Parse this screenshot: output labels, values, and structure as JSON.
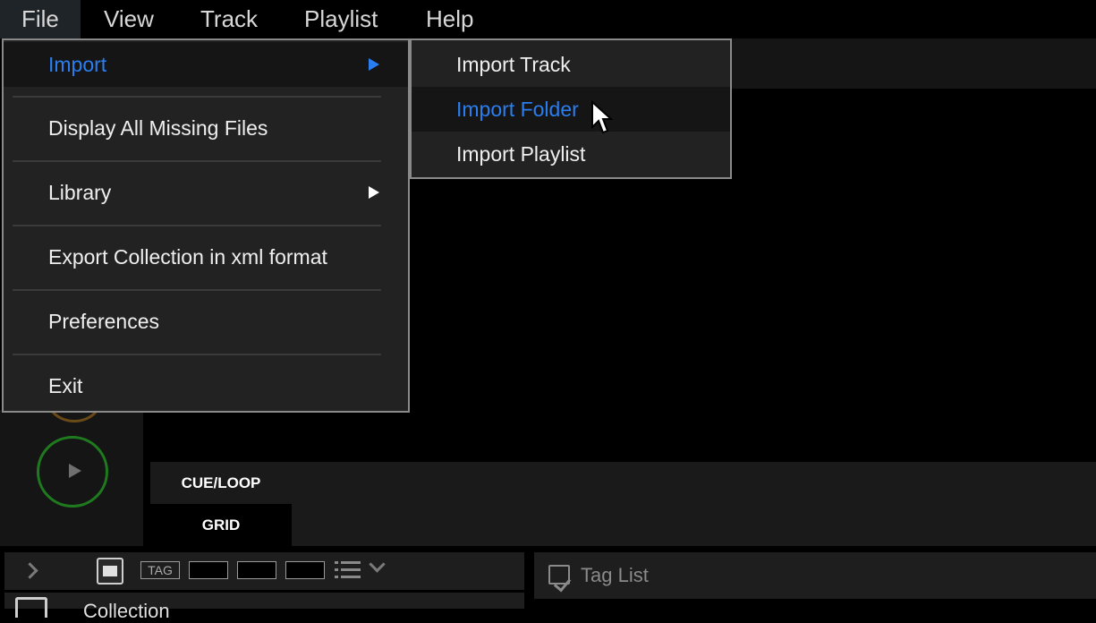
{
  "menubar": {
    "items": [
      "File",
      "View",
      "Track",
      "Playlist",
      "Help"
    ],
    "active": "File"
  },
  "file_menu": {
    "items": [
      {
        "label": "Import",
        "has_submenu": true,
        "highlighted": true
      },
      {
        "label": "Display All Missing Files",
        "has_submenu": false
      },
      {
        "label": "Library",
        "has_submenu": true
      },
      {
        "label": "Export Collection in xml format",
        "has_submenu": false
      },
      {
        "label": "Preferences",
        "has_submenu": false
      },
      {
        "label": "Exit",
        "has_submenu": false
      }
    ]
  },
  "import_submenu": {
    "items": [
      {
        "label": "Import Track"
      },
      {
        "label": "Import Folder",
        "highlighted": true
      },
      {
        "label": "Import Playlist"
      }
    ]
  },
  "deck": {
    "tabs": [
      "CUE/LOOP",
      "GRID"
    ],
    "play_icon": "play-icon"
  },
  "browser": {
    "tag_button": "TAG",
    "collection_label": "Collection"
  },
  "tag_list": {
    "label": "Tag List",
    "icon": "tag-list-icon"
  },
  "colors": {
    "highlight_text": "#2a7ef0",
    "menu_bg": "#222222",
    "play_ring": "#1f7a1f"
  }
}
